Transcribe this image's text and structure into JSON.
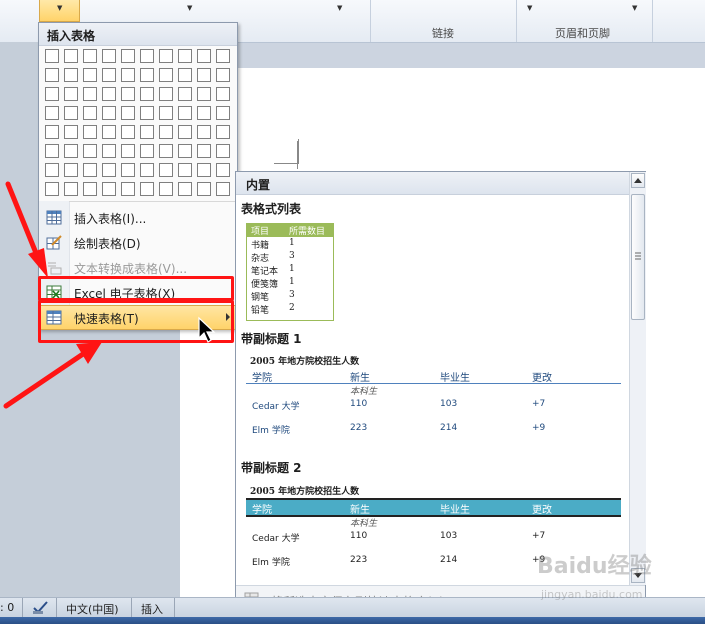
{
  "ribbon": {
    "groups": [
      "链接",
      "页眉和页脚"
    ]
  },
  "dropdown": {
    "title": "插入表格",
    "items": [
      {
        "label": "插入表格(I)...",
        "icon": "table-grid-icon",
        "enabled": true
      },
      {
        "label": "绘制表格(D)",
        "icon": "pencil-table-icon",
        "enabled": true
      },
      {
        "label": "文本转换成表格(V)...",
        "icon": "text-to-table-icon",
        "enabled": false
      },
      {
        "label": "Excel 电子表格(X)",
        "icon": "excel-sheet-icon",
        "enabled": true
      },
      {
        "label": "快速表格(T)",
        "icon": "quick-table-icon",
        "enabled": true,
        "has_submenu": true,
        "active": true
      }
    ]
  },
  "gallery": {
    "header": "内置",
    "sections": [
      {
        "title": "表格式列表",
        "preview": {
          "headers": [
            "项目",
            "所需数目"
          ],
          "rows": [
            [
              "书籍",
              "1"
            ],
            [
              "杂志",
              "3"
            ],
            [
              "笔记本",
              "1"
            ],
            [
              "便笺簿",
              "1"
            ],
            [
              "钢笔",
              "3"
            ],
            [
              "铅笔",
              "2"
            ]
          ]
        }
      },
      {
        "title": "带副标题 1",
        "preview": {
          "caption": "2005 年地方院校招生人数",
          "headers": [
            "学院",
            "新生",
            "毕业生",
            "更改"
          ],
          "subheader": "本科生",
          "rows": [
            [
              "Cedar 大学",
              "110",
              "103",
              "+7"
            ],
            [
              "Elm 学院",
              "223",
              "214",
              "+9"
            ]
          ]
        }
      },
      {
        "title": "带副标题 2",
        "preview": {
          "caption": "2005 年地方院校招生人数",
          "headers": [
            "学院",
            "新生",
            "毕业生",
            "更改"
          ],
          "subheader": "本科生",
          "rows": [
            [
              "Cedar 大学",
              "110",
              "103",
              "+7"
            ],
            [
              "Elm 学院",
              "223",
              "214",
              "+9"
            ]
          ]
        }
      }
    ],
    "footer_label": "将所选内容保存到快速表格库(S)..."
  },
  "statusbar": {
    "left_fragment": ": 0",
    "language": "中文(中国)",
    "mode": "插入"
  },
  "colors": {
    "highlight_red": "#ff1414",
    "menu_active": "#ffd36a",
    "list_green": "#9bbb59",
    "subhead2_teal": "#4bacc6"
  },
  "watermark": {
    "text": "Baidu经验",
    "url_text": "jingyan.baidu.com"
  }
}
